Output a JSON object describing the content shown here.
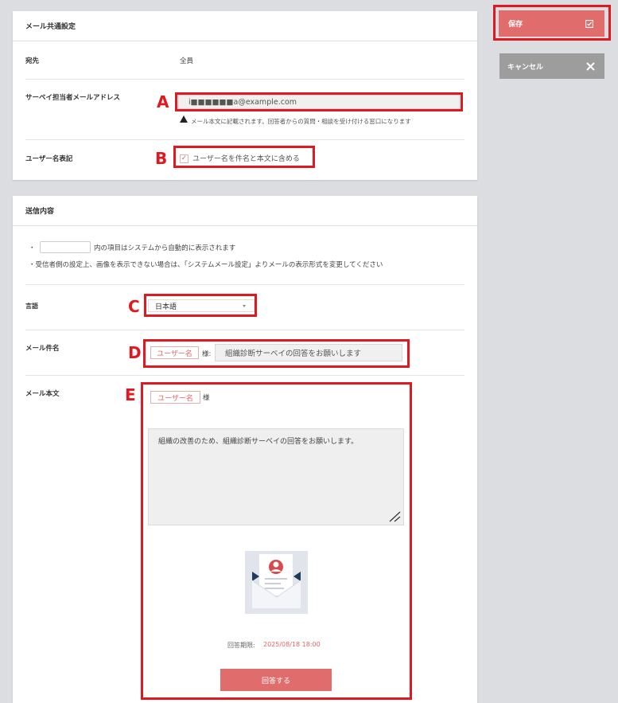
{
  "actions": {
    "save_label": "保存",
    "cancel_label": "キャンセル"
  },
  "mail_common": {
    "header": "メール共通設定",
    "recipient_label": "宛先",
    "recipient_value": "全員",
    "admin_email_label": "サーベイ担当者メールアドレス",
    "admin_email_value": "i■■■■■■a@example.com",
    "admin_email_note": "メール本文に記載されます。回答者からの質問・相談を受け付ける窓口になります",
    "username_label": "ユーザー名表記",
    "username_checkbox_label": "ユーザー名を件名と本文に含める",
    "username_checked": true
  },
  "send_content": {
    "header": "送信内容",
    "note1_suffix": "内の項目はシステムから自動的に表示されます",
    "note2": "・受信者側の設定上、画像を表示できない場合は、「システムメール設定」よりメールの表示形式を変更してください",
    "bullet": "・",
    "language_label": "言語",
    "language_value": "日本語",
    "subject_label": "メール件名",
    "subject_tag": "ユーザー名",
    "subject_honorific": "様:",
    "subject_value": "組織診断サーベイの回答をお願いします",
    "body_label": "メール本文",
    "body_tag": "ユーザー名",
    "body_honorific": "様",
    "body_text": "組織の改善のため、組織診断サーベイの回答をお願いします。",
    "deadline_label": "回答期限:",
    "deadline_value": "2025/08/18 18:00",
    "respond_button": "回答する"
  },
  "annotations": {
    "a": "A",
    "b": "B",
    "c": "C",
    "d": "D",
    "e": "E"
  },
  "colors": {
    "annotation_red": "#e0181f",
    "accent": "#e06c6b",
    "cancel_gray": "#9d9d9d"
  }
}
